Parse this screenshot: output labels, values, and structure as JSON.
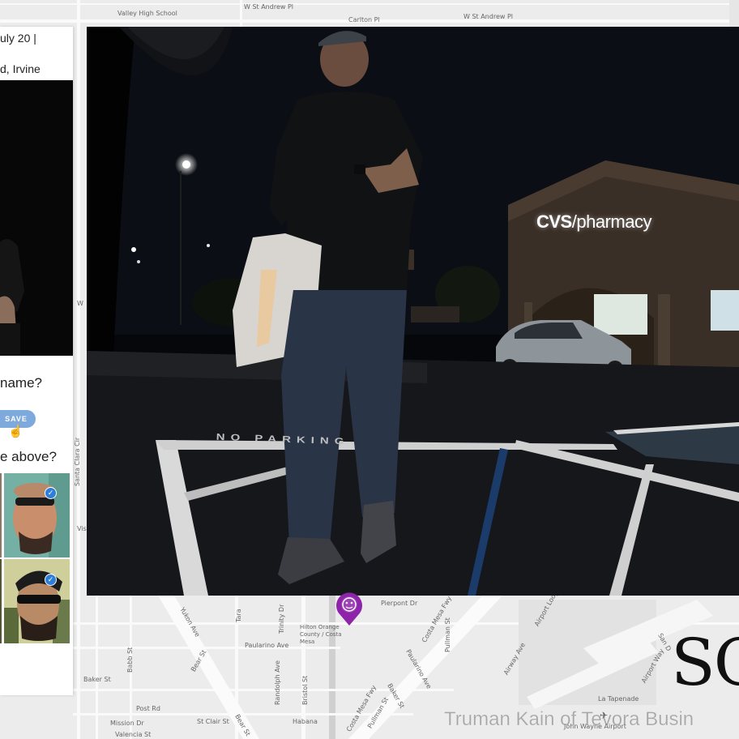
{
  "map": {
    "labels": {
      "valley_high_school": "Valley High School",
      "w_st_andrew_pl_top": "W St Andrew Pl",
      "carlton_pl": "Carlton Pl",
      "w_st_andrew_pl_right": "W St Andrew Pl",
      "santa_clara_cir": "Santa Clara Cir",
      "yukon_ave": "Yukon Ave",
      "tara": "Tara",
      "trinity_dr": "Trinity Dr",
      "pierpont_dr": "Pierpont Dr",
      "costa_mesa_fwy": "Costa Mesa Fwy",
      "airport_loop_dr": "Airport Loop Dr",
      "hilton": "Hilton Orange County / Costa Mesa",
      "paularino_ave_left": "Paularino Ave",
      "paularino_ave_right": "Paularino Ave",
      "pullman_st": "Pullman St",
      "airway_ave": "Airway Ave",
      "san_diego": "San D",
      "babb_st": "Babb St",
      "bear_st_top": "Bear St",
      "randolph_ave": "Randolph Ave",
      "bristol_st": "Bristol St",
      "baker_st_left": "Baker St",
      "baker_st_right": "Baker St",
      "post_rd": "Post Rd",
      "st_clair_st": "St Clair St",
      "bear_st_bottom": "Bear St",
      "habana": "Habana",
      "mission_dr": "Mission Dr",
      "valencia_st": "Valencia St",
      "costa_mesa_fwy_bottom": "Costa Mesa Fwy",
      "pullman_st_bottom": "Pullman St",
      "la_tapenade": "La Tapenade",
      "john_wayne_airport": "John Wayne Airport",
      "airport_way": "Airport Way",
      "w_left": "W",
      "visa": "Visa"
    }
  },
  "panel": {
    "date_fragment": "uly 20 |",
    "address_fragment": "d, Irvine",
    "question_name": "name?",
    "save_label": "SAVE",
    "question_above": "e above?"
  },
  "video": {
    "sign_brand": "CVS",
    "sign_rest": "/pharmacy",
    "pavement_text": "NO PARKING"
  },
  "overlay": {
    "logo_text": "SC",
    "caption": "Truman Kain of Tevora Busin"
  },
  "colors": {
    "save_button": "#7ea9dc",
    "check_badge": "#2f7fd8",
    "map_pin": "#8e24aa"
  },
  "icons": {
    "map_pin": "face-pin-icon",
    "cursor": "hand-cursor-icon",
    "check": "checkmark-icon",
    "airport": "airplane-icon"
  }
}
